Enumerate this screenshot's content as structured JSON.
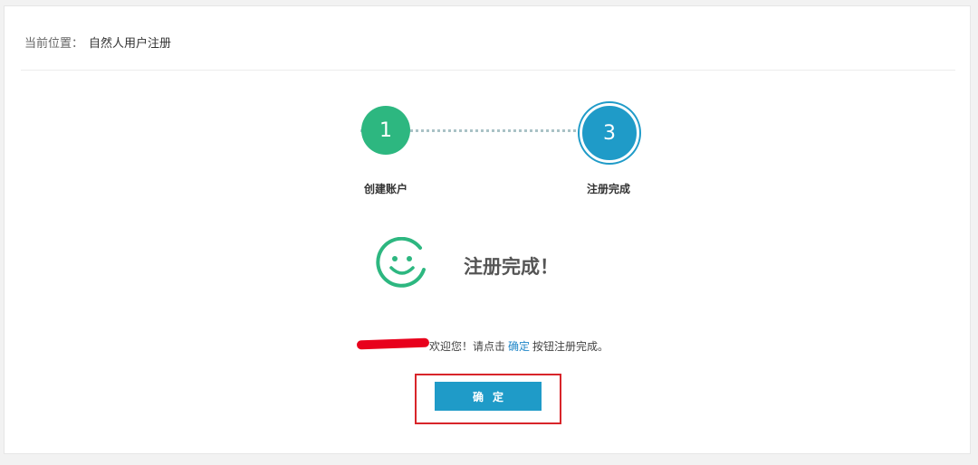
{
  "breadcrumb": {
    "label": "当前位置：",
    "current": "自然人用户注册"
  },
  "steps": [
    {
      "number": "1",
      "label": "创建账户",
      "status": "complete",
      "color": "#2db780"
    },
    {
      "number": "3",
      "label": "注册完成",
      "status": "current",
      "color": "#1f9bc8"
    }
  ],
  "result": {
    "icon": "smiley-icon",
    "title": "注册完成！"
  },
  "message": {
    "before": "欢迎您！请点击",
    "link": "确定",
    "after": "按钮注册完成。"
  },
  "confirm_button": {
    "label": "确定"
  },
  "colors": {
    "accent": "#1f9bc8",
    "success": "#2db780",
    "highlight": "#d8252a",
    "redaction": "#e8001c"
  }
}
